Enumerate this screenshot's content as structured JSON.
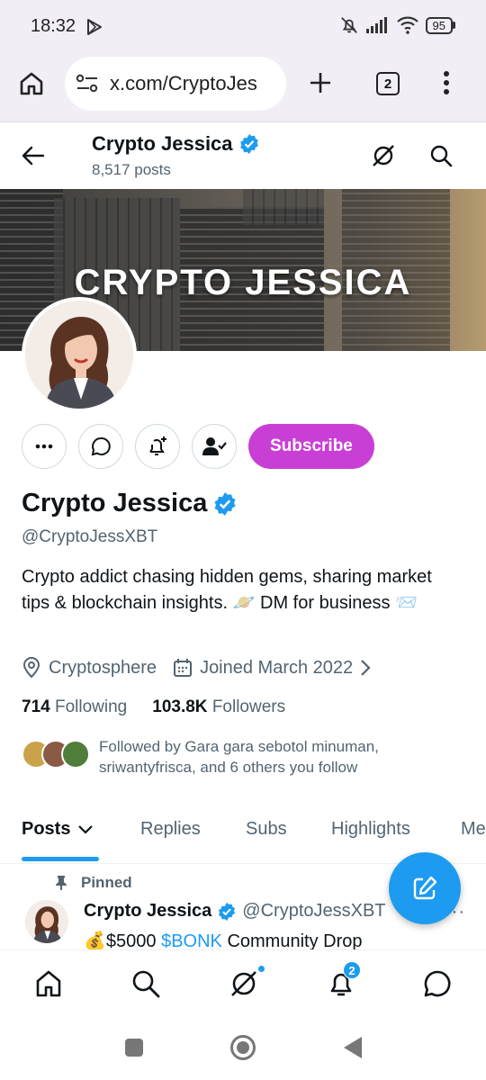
{
  "status_bar": {
    "time": "18:32",
    "battery": "95"
  },
  "browser": {
    "url": "x.com/CryptoJes",
    "tab_count": "2"
  },
  "header": {
    "title": "Crypto Jessica",
    "posts": "8,517 posts"
  },
  "banner": {
    "text": "CRYPTO JESSICA"
  },
  "profile": {
    "subscribe_label": "Subscribe",
    "name": "Crypto Jessica",
    "handle": "@CryptoJessXBT",
    "bio": "Crypto addict chasing hidden gems, sharing market tips & blockchain insights. 🪐  DM for business 📨",
    "location": "Cryptosphere",
    "joined": "Joined March 2022",
    "following_count": "714",
    "following_label": "Following",
    "followers_count": "103.8K",
    "followers_label": "Followers",
    "followed_by": "Followed by Gara gara sebotol minuman, sriwantyfrisca, and 6 others you follow"
  },
  "tabs": [
    "Posts",
    "Replies",
    "Subs",
    "Highlights",
    "Me"
  ],
  "pinned_tweet": {
    "pinned_label": "Pinned",
    "author": "Crypto Jessica",
    "handle": "@CryptoJessXBT",
    "text_emoji": "💰",
    "text_amount": "$5000 ",
    "text_cashtag": "$BONK",
    "text_rest": " Community Drop"
  },
  "bottom_nav": {
    "notifications_badge": "2"
  },
  "colors": {
    "accent": "#1d9bf0",
    "subscribe": "#c93fd6",
    "secondary_text": "#536471"
  }
}
